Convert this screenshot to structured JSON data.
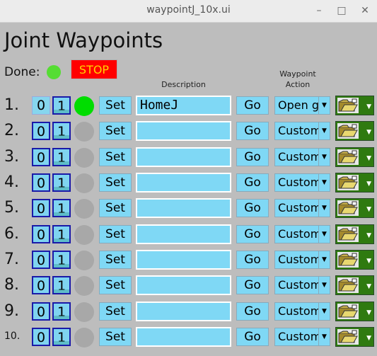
{
  "window": {
    "title": "waypointJ_10x.ui",
    "min_icon": "minimize-icon",
    "max_icon": "maximize-icon",
    "close_icon": "close-icon"
  },
  "heading": "Joint Waypoints",
  "done_label": "Done:",
  "stop_label": "STOP",
  "columns": {
    "description": "Description",
    "action_line1": "Waypoint",
    "action_line2": "Action"
  },
  "colors": {
    "led_on": "#00dd00",
    "led_off": "#a8a8a8",
    "done_led": "#55dd33",
    "stop": "#ff0000",
    "field": "#7fd8f5",
    "folder": "#2f7a10"
  },
  "rows": [
    {
      "num": "1.",
      "bit0": "0",
      "bit1": "1",
      "led_on": true,
      "set": "Set",
      "description": "HomeJ",
      "go": "Go",
      "action": "Open g"
    },
    {
      "num": "2.",
      "bit0": "0",
      "bit1": "1",
      "led_on": false,
      "set": "Set",
      "description": "",
      "go": "Go",
      "action": "Custom"
    },
    {
      "num": "3.",
      "bit0": "0",
      "bit1": "1",
      "led_on": false,
      "set": "Set",
      "description": "",
      "go": "Go",
      "action": "Custom"
    },
    {
      "num": "4.",
      "bit0": "0",
      "bit1": "1",
      "led_on": false,
      "set": "Set",
      "description": "",
      "go": "Go",
      "action": "Custom"
    },
    {
      "num": "5.",
      "bit0": "0",
      "bit1": "1",
      "led_on": false,
      "set": "Set",
      "description": "",
      "go": "Go",
      "action": "Custom"
    },
    {
      "num": "6.",
      "bit0": "0",
      "bit1": "1",
      "led_on": false,
      "set": "Set",
      "description": "",
      "go": "Go",
      "action": "Custom"
    },
    {
      "num": "7.",
      "bit0": "0",
      "bit1": "1",
      "led_on": false,
      "set": "Set",
      "description": "",
      "go": "Go",
      "action": "Custom"
    },
    {
      "num": "8.",
      "bit0": "0",
      "bit1": "1",
      "led_on": false,
      "set": "Set",
      "description": "",
      "go": "Go",
      "action": "Custom"
    },
    {
      "num": "9.",
      "bit0": "0",
      "bit1": "1",
      "led_on": false,
      "set": "Set",
      "description": "",
      "go": "Go",
      "action": "Custom"
    },
    {
      "num": "10.",
      "bit0": "0",
      "bit1": "1",
      "led_on": false,
      "set": "Set",
      "description": "",
      "go": "Go",
      "action": "Custom"
    }
  ]
}
